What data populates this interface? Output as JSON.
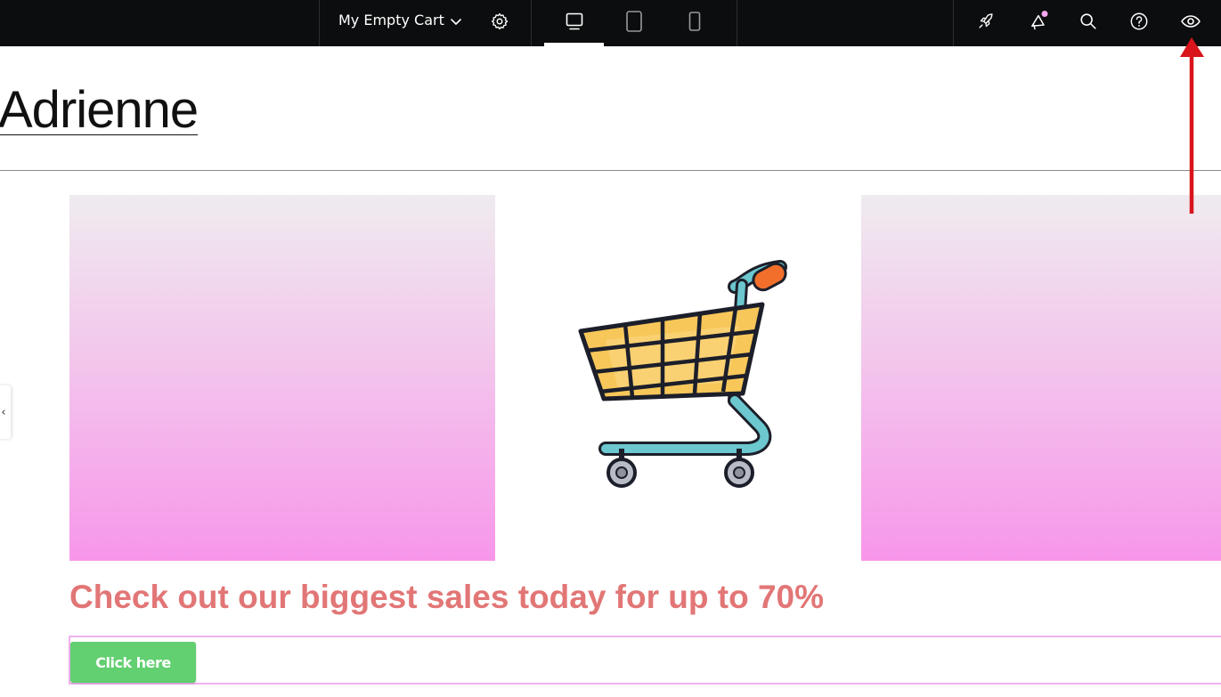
{
  "toolbar": {
    "document_title": "My Empty Cart",
    "icons": {
      "dropdown": "chevron-down-icon",
      "settings": "gear-icon",
      "desktop": "desktop-icon",
      "tablet": "tablet-icon",
      "mobile": "mobile-icon",
      "publish": "rocket-icon",
      "whats_new": "megaphone-icon",
      "finder": "search-icon",
      "help": "help-circle-icon",
      "preview": "eye-icon"
    },
    "notification_dot_color": "#f3a7f0"
  },
  "canvas": {
    "site_title": "Adrienne",
    "headline": "Check out our biggest sales today for up to 70%",
    "button_label": "Click here",
    "side_toggle_glyph": "‹",
    "colors": {
      "headline": "#e27676",
      "button": "#62cf71",
      "gradient_top": "#efebef",
      "gradient_bottom": "#f796ea",
      "section_outline": "#f0b3ee"
    }
  },
  "annotation": {
    "arrow_color": "#d9141b",
    "points_to": "preview"
  }
}
